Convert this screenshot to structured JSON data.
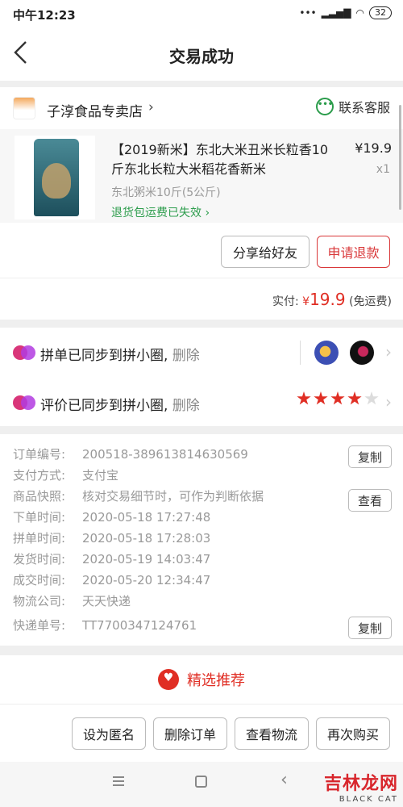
{
  "status_bar": {
    "time": "中午12:23",
    "battery": "32"
  },
  "nav": {
    "title": "交易成功"
  },
  "shop": {
    "name": "子淳食品专卖店",
    "service_label": "联系客服"
  },
  "product": {
    "title": "【2019新米】东北大米丑米长粒香10斤东北长粒大米稻花香新米",
    "price": "¥19.9",
    "quantity": "x1",
    "spec": "东北粥米10斤(5公斤)",
    "return_note": "退货包运费已失效"
  },
  "product_actions": {
    "share": "分享给好友",
    "refund": "申请退款"
  },
  "payment": {
    "label": "实付:",
    "currency": "¥",
    "amount": "19.9",
    "note": "(免运费)"
  },
  "sync": {
    "group_text": "拼单已同步到拼小圈,",
    "review_text": "评价已同步到拼小圈,",
    "delete_label": "删除",
    "rating": 4,
    "rating_max": 5
  },
  "order_info": {
    "rows": [
      {
        "key": "订单编号:",
        "value": "200518-389613814630569"
      },
      {
        "key": "支付方式:",
        "value": "支付宝"
      },
      {
        "key": "商品快照:",
        "value": "核对交易细节时，可作为判断依据"
      },
      {
        "key": "下单时间:",
        "value": "2020-05-18 17:27:48"
      },
      {
        "key": "拼单时间:",
        "value": "2020-05-18 17:28:03"
      },
      {
        "key": "发货时间:",
        "value": "2020-05-19 14:03:47"
      },
      {
        "key": "成交时间:",
        "value": "2020-05-20 12:34:47"
      },
      {
        "key": "物流公司:",
        "value": "天天快递"
      },
      {
        "key": "快递单号:",
        "value": "TT7700347124761"
      }
    ],
    "copy_label": "复制",
    "view_label": "查看"
  },
  "recommend": {
    "label": "精选推荐"
  },
  "bottom_actions": {
    "anonymous": "设为匿名",
    "delete_order": "删除订单",
    "view_logistics": "查看物流",
    "buy_again": "再次购买"
  },
  "watermark": {
    "cn": "吉林龙网",
    "en": "BLACK CAT"
  },
  "colors": {
    "accent_red": "#e02e24",
    "green": "#2b9c4b",
    "star": "#e02e24"
  }
}
